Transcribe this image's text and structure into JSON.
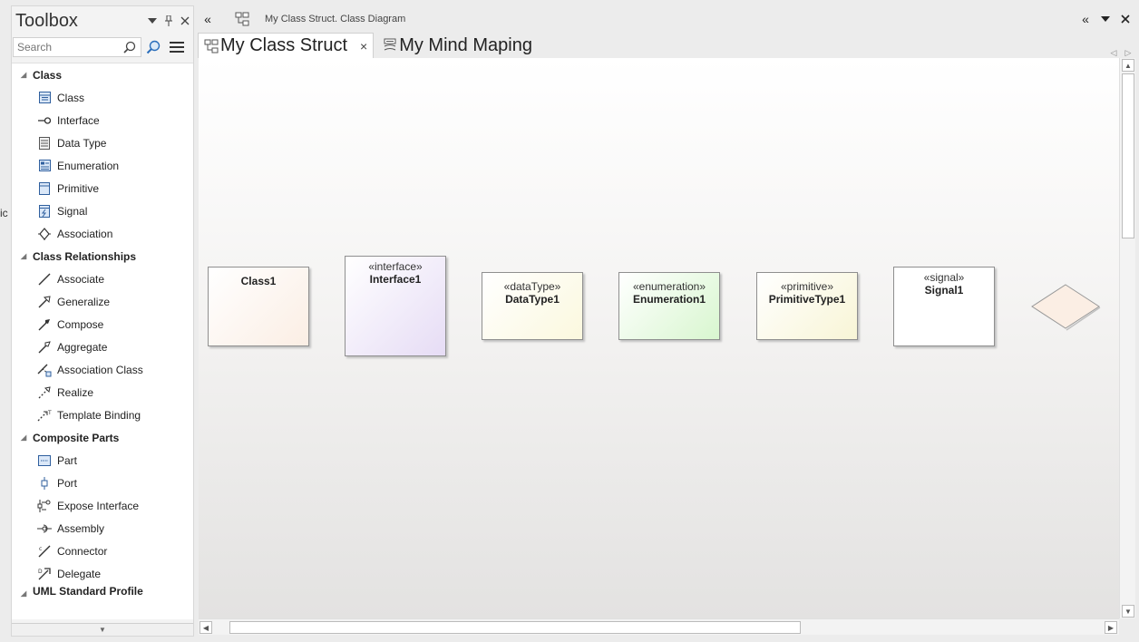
{
  "toolbox": {
    "title": "Toolbox",
    "search_placeholder": "Search",
    "groups": [
      {
        "label": "Class",
        "items": [
          {
            "label": "Class",
            "icon": "class-icon"
          },
          {
            "label": "Interface",
            "icon": "interface-icon"
          },
          {
            "label": "Data Type",
            "icon": "datatype-icon"
          },
          {
            "label": "Enumeration",
            "icon": "enumeration-icon"
          },
          {
            "label": "Primitive",
            "icon": "primitive-icon"
          },
          {
            "label": "Signal",
            "icon": "signal-icon"
          },
          {
            "label": "Association",
            "icon": "association-icon"
          }
        ]
      },
      {
        "label": "Class Relationships",
        "items": [
          {
            "label": "Associate",
            "icon": "associate-line-icon"
          },
          {
            "label": "Generalize",
            "icon": "generalize-arrow-icon"
          },
          {
            "label": "Compose",
            "icon": "compose-arrow-icon"
          },
          {
            "label": "Aggregate",
            "icon": "aggregate-arrow-icon"
          },
          {
            "label": "Association Class",
            "icon": "association-class-icon"
          },
          {
            "label": "Realize",
            "icon": "realize-arrow-icon"
          },
          {
            "label": "Template Binding",
            "icon": "template-binding-icon"
          }
        ]
      },
      {
        "label": "Composite Parts",
        "items": [
          {
            "label": "Part",
            "icon": "part-icon"
          },
          {
            "label": "Port",
            "icon": "port-icon"
          },
          {
            "label": "Expose Interface",
            "icon": "expose-interface-icon"
          },
          {
            "label": "Assembly",
            "icon": "assembly-icon"
          },
          {
            "label": "Connector",
            "icon": "connector-icon"
          },
          {
            "label": "Delegate",
            "icon": "delegate-icon"
          }
        ]
      }
    ],
    "partial_group": "UML Standard Profile"
  },
  "left_stub": "ic",
  "topbar": {
    "path": "My Class Struct.  Class Diagram"
  },
  "tabs": [
    {
      "label": "My Class Struct",
      "active": true,
      "close": "×"
    },
    {
      "label": "My Mind Maping",
      "active": false
    }
  ],
  "diagram": {
    "elements": [
      {
        "stereotype": "",
        "name": "Class1",
        "color": "#fbeee4"
      },
      {
        "stereotype": "«interface»",
        "name": "Interface1",
        "color": "#e6dcf5"
      },
      {
        "stereotype": "«dataType»",
        "name": "DataType1",
        "color": "#fbf8de"
      },
      {
        "stereotype": "«enumeration»",
        "name": "Enumeration1",
        "color": "#d8f6cf"
      },
      {
        "stereotype": "«primitive»",
        "name": "PrimitiveType1",
        "color": "#f8f5d6"
      },
      {
        "stereotype": "«signal»",
        "name": "Signal1",
        "color": "#ffffff"
      }
    ],
    "diamond_color": "#fbeee4"
  }
}
